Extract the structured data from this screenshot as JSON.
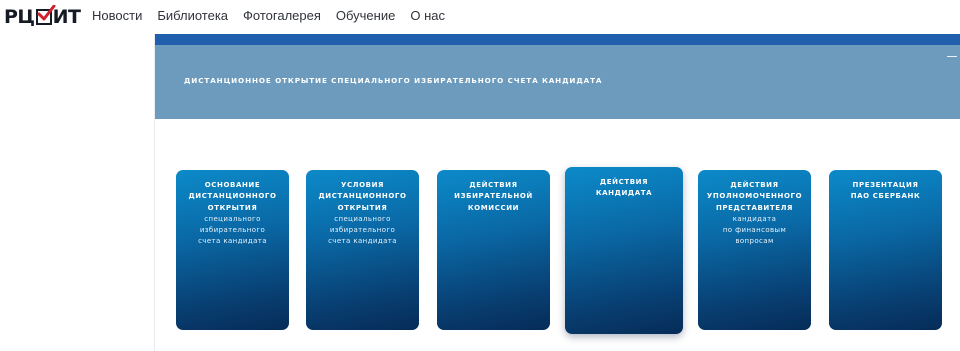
{
  "header": {
    "logo_text_left": "РЦ",
    "logo_text_right": "ИТ",
    "nav": [
      "Новости",
      "Библиотека",
      "Фотогалерея",
      "Обучение",
      "О нас"
    ]
  },
  "banner": {
    "title": "ДИСТАНЦИОННОЕ ОТКРЫТИЕ СПЕЦИАЛЬНОГО ИЗБИРАТЕЛЬНОГО СЧЕТА КАНДИДАТА",
    "collapse_icon": "minus-icon"
  },
  "cards": [
    {
      "bold": [
        "ОСНОВАНИЕ",
        "ДИСТАНЦИОННОГО",
        "ОТКРЫТИЯ"
      ],
      "normal": [
        "специального",
        "избирательного",
        "счета кандидата"
      ]
    },
    {
      "bold": [
        "УСЛОВИЯ",
        "ДИСТАНЦИОННОГО",
        "ОТКРЫТИЯ"
      ],
      "normal": [
        "специального",
        "избирательного",
        "счета кандидата"
      ]
    },
    {
      "bold": [
        "ДЕЙСТВИЯ",
        "ИЗБИРАТЕЛЬНОЙ",
        "КОМИССИИ"
      ],
      "normal": []
    },
    {
      "bold": [
        "ДЕЙСТВИЯ",
        "КАНДИДАТА"
      ],
      "normal": []
    },
    {
      "bold": [
        "ДЕЙСТВИЯ",
        "УПОЛНОМОЧЕННОГО",
        "ПРЕДСТАВИТЕЛЯ"
      ],
      "normal": [
        "кандидата",
        "по финансовым",
        "вопросам"
      ]
    },
    {
      "bold": [
        "ПРЕЗЕНТАЦИЯ",
        "ПАО СБЕРБАНК"
      ],
      "normal": []
    }
  ],
  "colors": {
    "banner": "#6c9bbd",
    "top_strip": "#1f5fad",
    "card_top": "#0c8ac9",
    "card_bottom": "#062c58",
    "logo_check": "#d0202e"
  }
}
